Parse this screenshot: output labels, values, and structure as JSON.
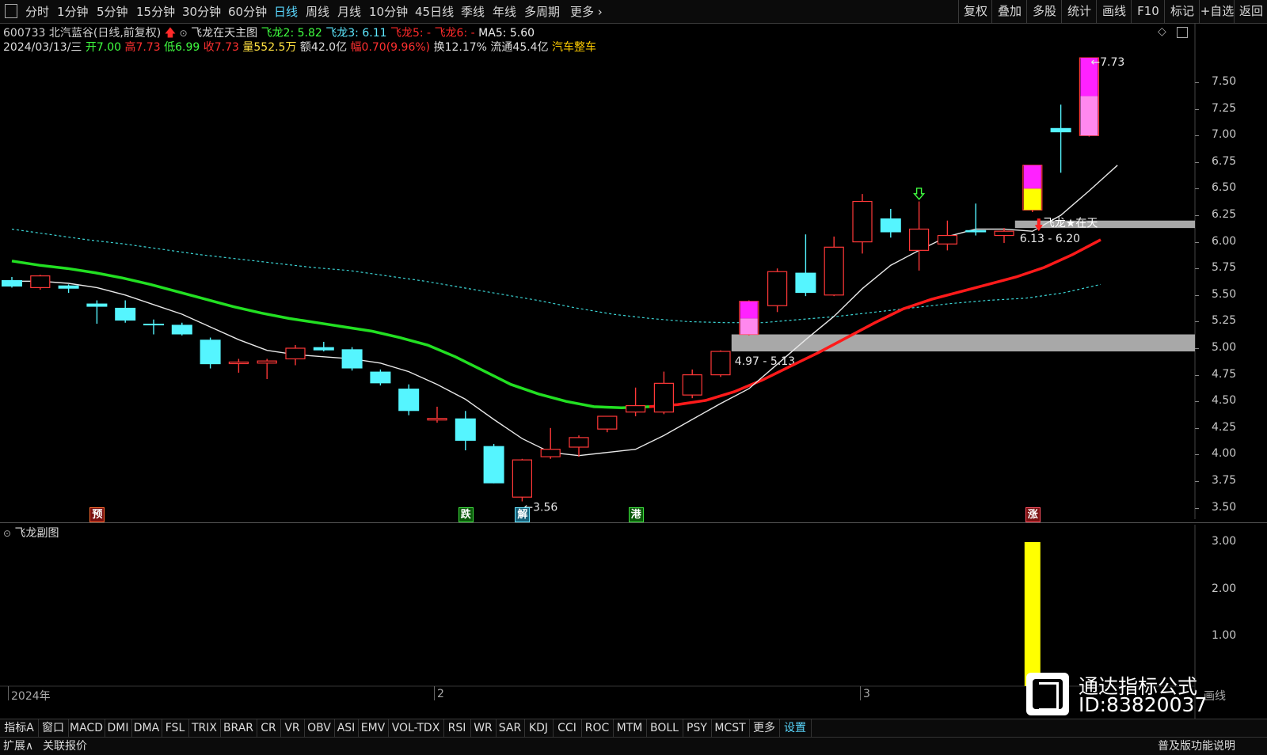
{
  "toolbar": {
    "periods": [
      "分时",
      "1分钟",
      "5分钟",
      "15分钟",
      "30分钟",
      "60分钟",
      "日线",
      "周线",
      "月线",
      "10分钟",
      "45日线",
      "季线",
      "年线",
      "多周期",
      "更多"
    ],
    "active_period": "日线",
    "right_buttons": [
      "复权",
      "叠加",
      "多股",
      "统计",
      "画线",
      "F10",
      "标记",
      "+自选",
      "返回"
    ]
  },
  "stock": {
    "code_name": "600733 北汽蓝谷(日线,前复权)",
    "indicator_name": "飞龙在天主图",
    "fl2_label": "飞龙2: 5.82",
    "fl3_label": "飞龙3: 6.11",
    "fl5_label": "飞龙5: -",
    "fl6_label": "飞龙6: -",
    "ma5_label": "MA5: 5.60"
  },
  "quote": {
    "date": "2024/03/13/三",
    "open": "开7.00",
    "high": "高7.73",
    "low": "低6.99",
    "close": "收7.73",
    "volume": "量552.5万",
    "amount": "额42.0亿",
    "change": "幅0.70(9.96%)",
    "turnover": "换12.17%",
    "float": "流通45.4亿",
    "sector": "汽车整车"
  },
  "chart_data": {
    "type": "candlestick",
    "y_axis_ticks": [
      "7.50",
      "7.25",
      "7.00",
      "6.75",
      "6.50",
      "6.25",
      "6.00",
      "5.75",
      "5.50",
      "5.25",
      "5.00",
      "4.75",
      "4.50",
      "4.25",
      "4.00",
      "3.75",
      "3.50"
    ],
    "ylim": [
      3.45,
      7.75
    ],
    "candles": [
      {
        "o": 5.64,
        "h": 5.67,
        "l": 5.57,
        "c": 5.58
      },
      {
        "o": 5.57,
        "h": 5.69,
        "l": 5.55,
        "c": 5.68
      },
      {
        "o": 5.59,
        "h": 5.6,
        "l": 5.52,
        "c": 5.56
      },
      {
        "o": 5.42,
        "h": 5.45,
        "l": 5.23,
        "c": 5.39
      },
      {
        "o": 5.38,
        "h": 5.45,
        "l": 5.24,
        "c": 5.26
      },
      {
        "o": 5.23,
        "h": 5.27,
        "l": 5.13,
        "c": 5.22
      },
      {
        "o": 5.22,
        "h": 5.24,
        "l": 5.12,
        "c": 5.13
      },
      {
        "o": 5.08,
        "h": 5.1,
        "l": 4.81,
        "c": 4.85
      },
      {
        "o": 4.87,
        "h": 4.9,
        "l": 4.77,
        "c": 4.87
      },
      {
        "o": 4.86,
        "h": 4.9,
        "l": 4.71,
        "c": 4.88
      },
      {
        "o": 4.9,
        "h": 5.03,
        "l": 4.84,
        "c": 5.0
      },
      {
        "o": 5.01,
        "h": 5.06,
        "l": 4.97,
        "c": 4.98
      },
      {
        "o": 4.99,
        "h": 5.01,
        "l": 4.79,
        "c": 4.81
      },
      {
        "o": 4.78,
        "h": 4.8,
        "l": 4.65,
        "c": 4.67
      },
      {
        "o": 4.62,
        "h": 4.66,
        "l": 4.37,
        "c": 4.41
      },
      {
        "o": 4.34,
        "h": 4.45,
        "l": 4.3,
        "c": 4.34
      },
      {
        "o": 4.34,
        "h": 4.41,
        "l": 4.04,
        "c": 4.13
      },
      {
        "o": 4.08,
        "h": 4.1,
        "l": 3.73,
        "c": 3.73
      },
      {
        "o": 3.6,
        "h": 3.96,
        "l": 3.56,
        "c": 3.95
      },
      {
        "o": 3.98,
        "h": 4.25,
        "l": 3.96,
        "c": 4.05
      },
      {
        "o": 4.07,
        "h": 4.18,
        "l": 3.98,
        "c": 4.16
      },
      {
        "o": 4.24,
        "h": 4.36,
        "l": 4.21,
        "c": 4.36
      },
      {
        "o": 4.4,
        "h": 4.63,
        "l": 4.36,
        "c": 4.46
      },
      {
        "o": 4.4,
        "h": 4.78,
        "l": 4.38,
        "c": 4.67
      },
      {
        "o": 4.56,
        "h": 4.8,
        "l": 4.53,
        "c": 4.75
      },
      {
        "o": 4.75,
        "h": 4.98,
        "l": 4.73,
        "c": 4.97
      },
      {
        "o": 5.13,
        "h": 5.45,
        "l": 5.12,
        "c": 5.44
      },
      {
        "o": 5.4,
        "h": 5.75,
        "l": 5.34,
        "c": 5.72
      },
      {
        "o": 5.71,
        "h": 6.07,
        "l": 5.49,
        "c": 5.52
      },
      {
        "o": 5.5,
        "h": 6.05,
        "l": 5.49,
        "c": 5.95
      },
      {
        "o": 6.0,
        "h": 6.45,
        "l": 5.89,
        "c": 6.38
      },
      {
        "o": 6.22,
        "h": 6.31,
        "l": 6.04,
        "c": 6.09
      },
      {
        "o": 5.92,
        "h": 6.38,
        "l": 5.73,
        "c": 6.12
      },
      {
        "o": 5.98,
        "h": 6.2,
        "l": 5.92,
        "c": 6.06
      },
      {
        "o": 6.11,
        "h": 6.36,
        "l": 6.06,
        "c": 6.09
      },
      {
        "o": 6.06,
        "h": 6.13,
        "l": 5.99,
        "c": 6.1
      },
      {
        "o": 6.3,
        "h": 6.72,
        "l": 6.28,
        "c": 6.72
      },
      {
        "o": 7.07,
        "h": 7.29,
        "l": 6.65,
        "c": 7.03
      },
      {
        "o": 7.0,
        "h": 7.73,
        "l": 6.99,
        "c": 7.73
      }
    ],
    "ma_white": [
      5.63,
      5.63,
      5.61,
      5.57,
      5.5,
      5.41,
      5.32,
      5.2,
      5.08,
      4.98,
      4.94,
      4.92,
      4.9,
      4.86,
      4.78,
      4.66,
      4.52,
      4.33,
      4.15,
      4.02,
      3.99,
      4.02,
      4.05,
      4.18,
      4.33,
      4.48,
      4.62,
      4.85,
      5.08,
      5.3,
      5.56,
      5.78,
      5.92,
      6.05,
      6.12,
      6.12,
      6.1,
      6.25,
      6.48,
      6.72
    ],
    "ma_green": [
      5.82,
      5.78,
      5.75,
      5.71,
      5.66,
      5.6,
      5.53,
      5.46,
      5.39,
      5.33,
      5.28,
      5.24,
      5.2,
      5.16,
      5.1,
      5.03,
      4.92,
      4.79,
      4.66,
      4.57,
      4.5,
      4.45,
      4.44,
      4.45
    ],
    "ma_red": [
      4.45,
      4.47,
      4.51,
      4.59,
      4.7,
      4.83,
      4.96,
      5.1,
      5.24,
      5.37,
      5.46,
      5.53,
      5.6,
      5.67,
      5.76,
      5.88,
      6.02
    ],
    "ma_cyan_dotted": [
      6.12,
      6.07,
      6.02,
      5.98,
      5.93,
      5.88,
      5.84,
      5.8,
      5.76,
      5.73,
      5.68,
      5.63,
      5.57,
      5.51,
      5.45,
      5.38,
      5.32,
      5.28,
      5.25,
      5.24,
      5.24,
      5.27,
      5.3,
      5.34,
      5.38,
      5.42,
      5.45,
      5.47,
      5.52,
      5.6
    ],
    "zones": [
      {
        "low": 4.97,
        "high": 5.13,
        "label": "4.97 - 5.13",
        "from_index": 26
      },
      {
        "low": 6.13,
        "high": 6.2,
        "label": "6.13 - 6.20",
        "from_index": 36
      }
    ],
    "annotations": {
      "low_label": "←3.56",
      "high_label": "←7.73",
      "feilong_label": "飞龙★在天",
      "signals": [
        {
          "index": 3,
          "text": "预",
          "color": "#ff6a30"
        },
        {
          "index": 16,
          "text": "跌",
          "color": "#3fe03f"
        },
        {
          "index": 18,
          "text": "解",
          "color": "#69e5ff"
        },
        {
          "index": 22,
          "text": "港",
          "color": "#3fe03f"
        },
        {
          "index": 36,
          "text": "涨",
          "color": "#ff5060"
        }
      ]
    },
    "sub_chart": {
      "title": "飞龙副图",
      "y_axis_ticks": [
        "3.00",
        "2.00",
        "1.00"
      ],
      "ylim": [
        0,
        3.3
      ],
      "bars": [
        {
          "index": 36,
          "value": 3.0
        }
      ],
      "date_labels": [
        "2024年",
        "2",
        "3"
      ],
      "right_label": "画线"
    },
    "colors": {
      "up": "#ff3838",
      "down": "#55f5ff",
      "ma_white": "#e8e8e8",
      "ma_green": "#22e022",
      "ma_red": "#ff1a1a",
      "ma_cyan": "#3bd6d6",
      "zone": "#a8a8a8",
      "magenta": "#ff22ff",
      "yellow": "#ffff00"
    }
  },
  "bottom_tabs": [
    "指标A",
    "窗口",
    "MACD",
    "DMI",
    "DMA",
    "FSL",
    "TRIX",
    "BRAR",
    "CR",
    "VR",
    "OBV",
    "ASI",
    "EMV",
    "VOL-TDX",
    "RSI",
    "WR",
    "SAR",
    "KDJ",
    "CCI",
    "ROC",
    "MTM",
    "BOLL",
    "PSY",
    "MCST",
    "更多",
    "设置"
  ],
  "status_bar": {
    "expand": "扩展∧",
    "related": "关联报价",
    "right": "普及版功能说明"
  },
  "watermark": {
    "line1": "通达指标公式",
    "line2": "ID:83820037"
  }
}
